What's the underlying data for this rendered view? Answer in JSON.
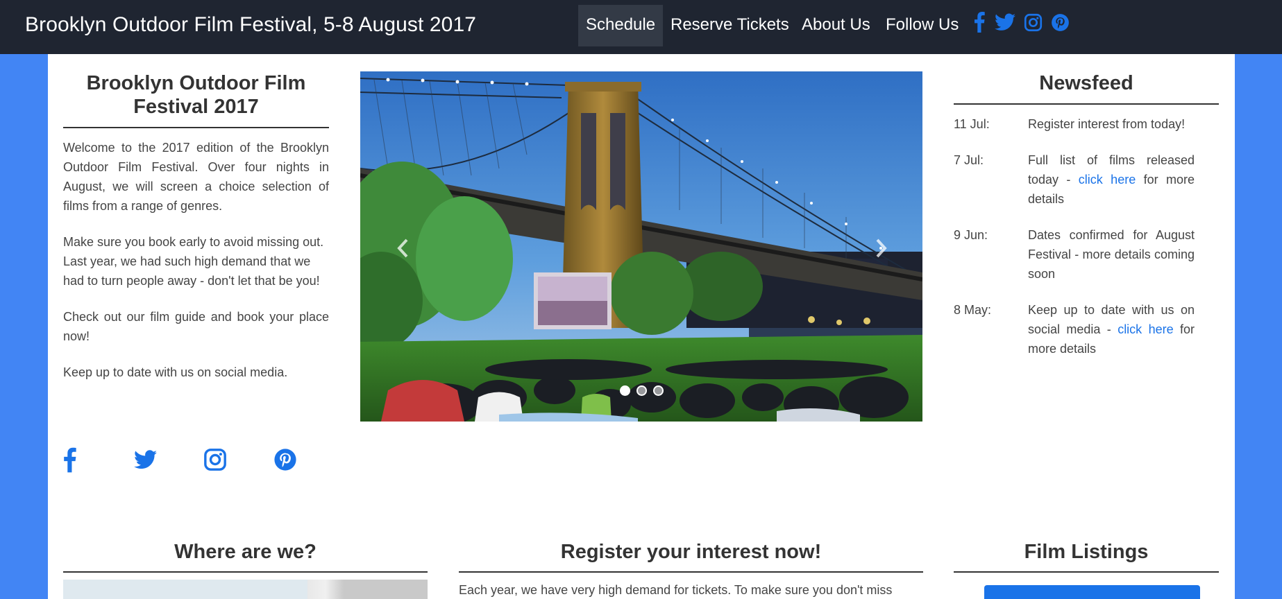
{
  "navbar": {
    "brand": "Brooklyn Outdoor Film Festival, 5-8 August 2017",
    "items": [
      {
        "label": "Schedule",
        "active": true
      },
      {
        "label": "Reserve Tickets",
        "active": false
      },
      {
        "label": "About Us",
        "active": false
      },
      {
        "label": "Follow Us",
        "active": false
      }
    ],
    "social_icons": [
      "facebook-icon",
      "twitter-icon",
      "instagram-icon",
      "pinterest-icon"
    ]
  },
  "colors": {
    "nav_bg": "#1f2531",
    "page_bg": "#4285f4",
    "accent": "#1a73e8",
    "text": "#333333"
  },
  "intro": {
    "title": "Brooklyn Outdoor Film Festival 2017",
    "paragraphs": [
      "Welcome to the 2017 edition of the Brooklyn Outdoor Film Festival. Over four nights in August, we will screen a choice selection of films from a range of genres.",
      "Make sure you book early to avoid missing out. Last year, we had such high demand that we had to turn people away - don't let that be you!",
      "Check out our film guide and book your place now!",
      "Keep up to date with us on social media."
    ],
    "social_icons": [
      "facebook-icon",
      "twitter-icon",
      "instagram-icon",
      "pinterest-icon"
    ]
  },
  "carousel": {
    "image": "outdoor-screening-under-brooklyn-bridge",
    "prev_icon": "chevron-left-icon",
    "next_icon": "chevron-right-icon",
    "slides": 3,
    "active_slide": 1
  },
  "newsfeed": {
    "title": "Newsfeed",
    "items": [
      {
        "date": "11 Jul:",
        "text": "Register interest from today!",
        "link": "",
        "after": ""
      },
      {
        "date": "7 Jul:",
        "text": "Full list of films released today - ",
        "link": "click here",
        "after": " for more details"
      },
      {
        "date": "9 Jun:",
        "text": "Dates confirmed for August Festival - more details coming soon",
        "link": "",
        "after": ""
      },
      {
        "date": "8 May:",
        "text": "Keep up to date with us on social media - ",
        "link": "click here",
        "after": " for more details"
      }
    ]
  },
  "sections": {
    "where": {
      "title": "Where are we?"
    },
    "register": {
      "title": "Register your interest now!",
      "text": "Each year, we have very high demand for tickets. To make sure you don't miss"
    },
    "films": {
      "title": "Film Listings"
    }
  }
}
